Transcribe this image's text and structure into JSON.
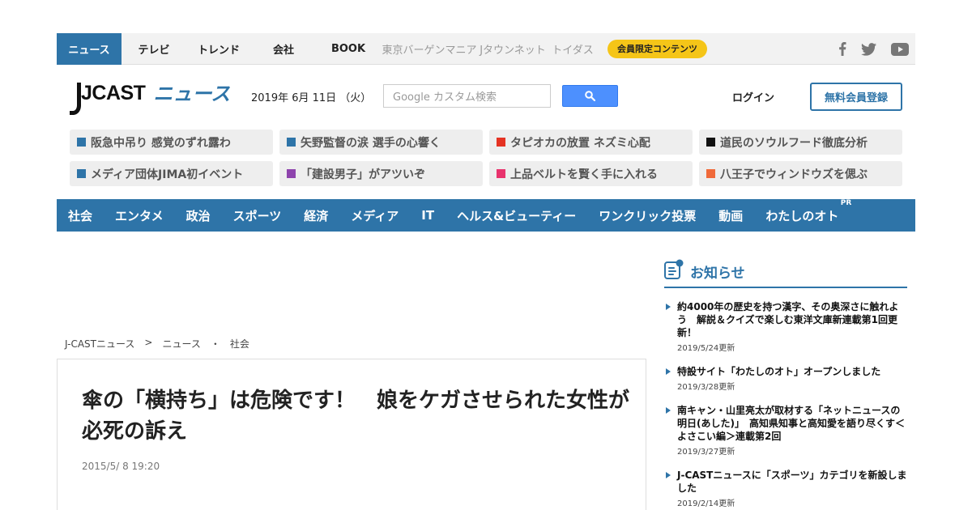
{
  "topbar": {
    "tabs": [
      "ニュース",
      "テレビ",
      "トレンド",
      "会社",
      "BOOK"
    ],
    "sub_tabs": [
      "東京バーゲンマニア",
      "Jタウンネット",
      "トイダス"
    ],
    "member_label": "会員限定コンテンツ",
    "social": [
      "facebook-icon",
      "twitter-icon",
      "youtube-icon"
    ]
  },
  "header": {
    "logo_jcast": "JCAST",
    "logo_news": "ニュース",
    "date": "2019年 6月 11日 （火）",
    "search_placeholder": "Google カスタム検索",
    "login": "ログイン",
    "register": "無料会員登録"
  },
  "trending": [
    {
      "label": "阪急中吊り 感覚のずれ露わ",
      "color": "#2e74a8"
    },
    {
      "label": "矢野監督の涙 選手の心響く",
      "color": "#2e74a8"
    },
    {
      "label": "タピオカの放置 ネズミ心配",
      "color": "#e53323"
    },
    {
      "label": "道民のソウルフード徹底分析",
      "color": "#111111"
    },
    {
      "label": "メディア団体JIMA初イベント",
      "color": "#2e74a8"
    },
    {
      "label": "「建設男子」がアツいぞ",
      "color": "#8e44ad"
    },
    {
      "label": "上品ベルトを賢く手に入れる",
      "color": "#e8336d"
    },
    {
      "label": "八王子でウィンドウズを偲ぶ",
      "color": "#f06a3a"
    }
  ],
  "categories": [
    "社会",
    "エンタメ",
    "政治",
    "スポーツ",
    "経済",
    "メディア",
    "IT",
    "ヘルス&ビューティー",
    "ワンクリック投票",
    "動画",
    "わたしのオト"
  ],
  "pr_label": "PR",
  "breadcrumb": [
    "J-CASTニュース",
    ">",
    "ニュース",
    "・",
    "社会"
  ],
  "article": {
    "title": "傘の「横持ち」は危険です！　娘をケガさせられた女性が必死の訴え",
    "time": "2015/5/ 8 19:20"
  },
  "notices": {
    "title": "お知らせ",
    "items": [
      {
        "text": "約4000年の歴史を持つ漢字、その奥深さに触れよう　解説＆クイズで楽しむ東洋文庫新連載第1回更新！",
        "date": "2019/5/24更新"
      },
      {
        "text": "特設サイト「わたしのオト」オープンしました",
        "date": "2019/3/28更新"
      },
      {
        "text": "南キャン・山里亮太が取材する「ネットニュースの明日(あした)」　高知県知事と高知愛を語り尽くす＜よさこい編＞連載第2回",
        "date": "2019/3/27更新"
      },
      {
        "text": "J-CASTニュースに「スポーツ」カテゴリを新設しました",
        "date": "2019/2/14更新"
      }
    ]
  }
}
